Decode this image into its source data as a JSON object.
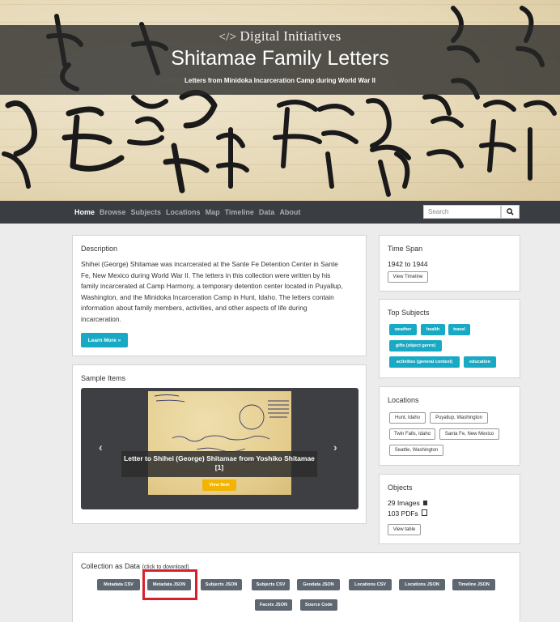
{
  "header": {
    "brand_code": "</>",
    "brand": "Digital Initiatives",
    "title": "Shitamae Family Letters",
    "subtitle": "Letters from Minidoka Incarceration Camp during World War II"
  },
  "nav": {
    "items": [
      "Home",
      "Browse",
      "Subjects",
      "Locations",
      "Map",
      "Timeline",
      "Data",
      "About"
    ],
    "active": "Home",
    "search_placeholder": "Search",
    "search_icon": "search-icon"
  },
  "description": {
    "title": "Description",
    "text": "Shihei (George) Shitamae was incarcerated at the Sante Fe Detention Center in Sante Fe, New Mexico during World War II. The letters in this collection were written by his family incarcerated at Camp Harmony, a temporary detention center located in Puyallup, Washington, and the Minidoka Incarceration Camp in Hunt, Idaho. The letters contain information about family members, activities, and other aspects of life during incarceration.",
    "button": "Learn More »"
  },
  "sample": {
    "title": "Sample Items",
    "caption": "Letter to Shihei (George) Shitamae from Yoshiko Shitamae [1]",
    "button": "View Item",
    "prev_icon": "chevron-left-icon",
    "next_icon": "chevron-right-icon"
  },
  "timespan": {
    "title": "Time Span",
    "range": "1942 to 1944",
    "button": "View Timeline"
  },
  "subjects": {
    "title": "Top Subjects",
    "tags": [
      "weather",
      "health",
      "travel",
      "gifts (object genre)",
      "activities (general context)",
      "education"
    ]
  },
  "locations": {
    "title": "Locations",
    "tags": [
      "Hunt, Idaho",
      "Puyallup, Washington",
      "Twin Falls, Idaho",
      "Santa Fe, New Mexico",
      "Seattle, Washington"
    ]
  },
  "objects": {
    "title": "Objects",
    "images": "29 Images",
    "pdfs": "103 PDFs",
    "button": "View table"
  },
  "data_panel": {
    "title": "Collection as Data",
    "note": "(click to download)",
    "buttons": [
      "Metadata CSV",
      "Metadata JSON",
      "Subjects JSON",
      "Subjects CSV",
      "Geodata JSON",
      "Locations CSV",
      "Locations JSON",
      "Timeline JSON",
      "Facets JSON",
      "Source Code"
    ],
    "highlighted": "Metadata JSON",
    "colors": {
      "button": "#5e6670",
      "highlight": "#d8202c"
    }
  },
  "colors": {
    "accent": "#18a9c4",
    "nav": "#3a3d42",
    "view_item": "#f2b400"
  }
}
